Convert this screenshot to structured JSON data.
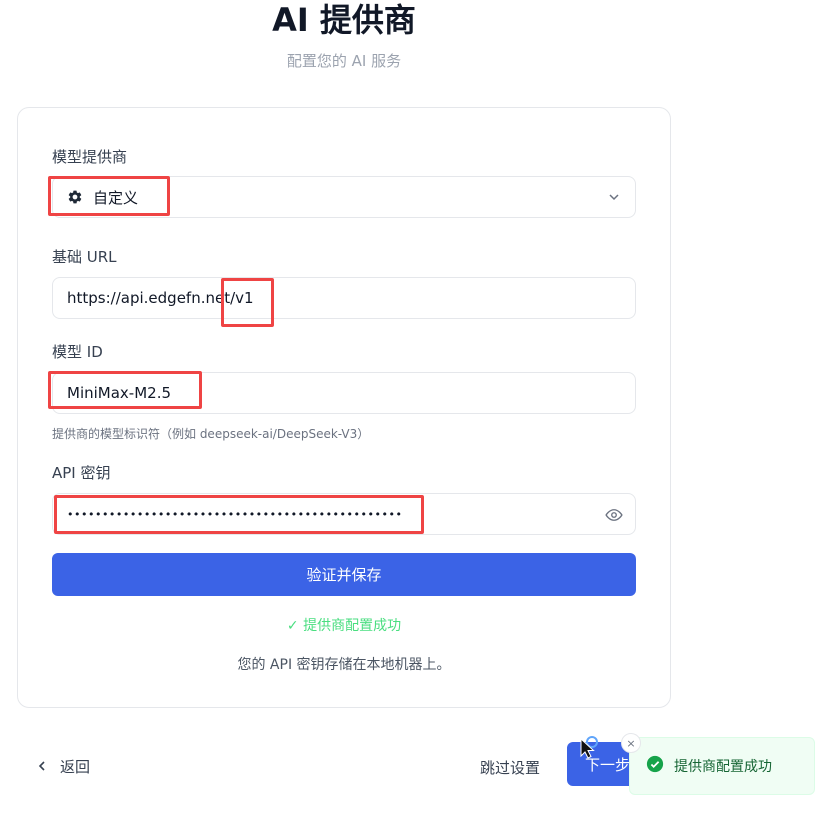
{
  "header": {
    "title": "AI 提供商",
    "subtitle": "配置您的 AI 服务"
  },
  "form": {
    "provider_label": "模型提供商",
    "provider_value": "自定义",
    "provider_icon": "gear-icon",
    "base_url_label": "基础 URL",
    "base_url_value": "https://api.edgefn.net/v1",
    "model_id_label": "模型 ID",
    "model_id_value": "MiniMax-M2.5",
    "model_id_hint": "提供商的模型标识符（例如 deepseek-ai/DeepSeek-V3）",
    "api_key_label": "API 密钥",
    "api_key_masked": "••••••••••••••••••••••••••••••••••••••••••••••••",
    "verify_button": "验证并保存",
    "success_message": "✓ 提供商配置成功",
    "storage_note": "您的 API 密钥存储在本地机器上。"
  },
  "footer": {
    "back_label": "返回",
    "skip_label": "跳过设置",
    "next_label": "下一步"
  },
  "toast": {
    "message": "提供商配置成功",
    "close_glyph": "×"
  },
  "colors": {
    "primary": "#3b63e6",
    "success": "#22c55e",
    "highlight": "#ef4444"
  }
}
